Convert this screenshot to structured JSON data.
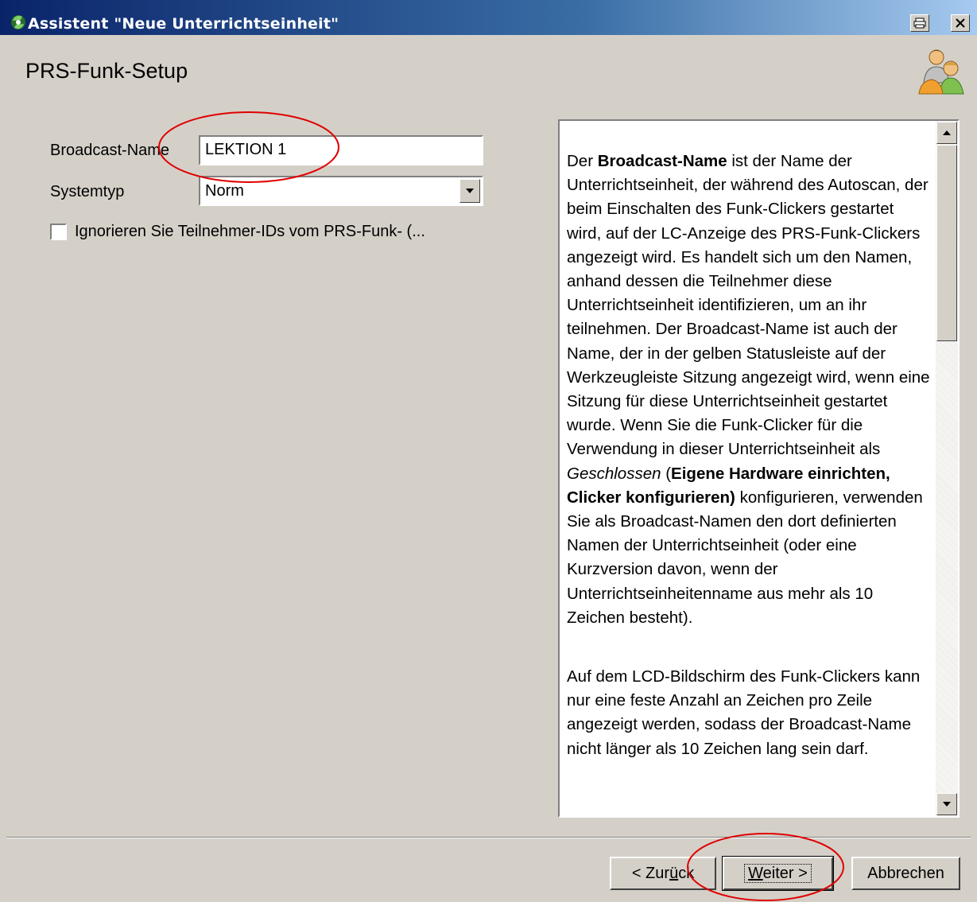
{
  "window": {
    "title": "Assistent \"Neue Unterrichtseinheit\""
  },
  "page": {
    "title": "PRS-Funk-Setup"
  },
  "form": {
    "broadcast_label": "Broadcast-Name",
    "broadcast_value": "LEKTION 1",
    "systemtype_label": "Systemtyp",
    "systemtype_value": "Norm",
    "ignore_ids_label": "Ignorieren Sie Teilnehmer-IDs vom PRS-Funk- (...",
    "ignore_ids_checked": false
  },
  "help": {
    "p1_a": "Der ",
    "p1_b": "Broadcast-Name",
    "p1_c": " ist der Name der Unterrichtseinheit, der während des Autoscan, der beim Einschalten des Funk-Clickers gestartet wird, auf der LC-Anzeige des PRS-Funk-Clickers angezeigt wird. Es handelt sich um den Namen, anhand dessen die Teilnehmer diese Unterrichtseinheit identifizieren, um an ihr teilnehmen. Der Broadcast-Name ist auch der Name, der in der gelben Statusleiste auf der Werkzeugleiste Sitzung angezeigt wird, wenn eine Sitzung für diese Unterrichtseinheit gestartet wurde. Wenn Sie die Funk-Clicker für die Verwendung in dieser Unterrichtseinheit als ",
    "p1_d": "Geschlossen",
    "p1_e": " (",
    "p1_f": "Eigene Hardware einrichten, Clicker konfigurieren)",
    "p1_g": " konfigurieren, verwenden Sie als Broadcast-Namen den dort definierten Namen der Unterrichtseinheit (oder eine Kurzversion davon, wenn der Unterrichtseinheitenname aus mehr als 10 Zeichen besteht).",
    "p2": "Auf dem LCD-Bildschirm des Funk-Clickers kann nur eine feste Anzahl an Zeichen pro Zeile angezeigt werden, sodass der Broadcast-Name nicht länger als 10 Zeichen lang sein darf."
  },
  "buttons": {
    "back_pre": "< Zur",
    "back_mnemonic": "ü",
    "back_post": "ck",
    "next_mnemonic": "W",
    "next_post": "eiter >",
    "cancel": "Abbrechen"
  },
  "colors": {
    "titlebar_start": "#0a246a",
    "titlebar_end": "#a6caf0",
    "dialog_bg": "#d4d0c8",
    "annotation": "#e00000"
  },
  "icons": {
    "app": "app-icon",
    "print": "print-icon",
    "close": "close-icon",
    "header": "people-icon",
    "dropdown": "chevron-down-icon",
    "scroll_up": "scroll-up-icon",
    "scroll_down": "scroll-down-icon"
  }
}
